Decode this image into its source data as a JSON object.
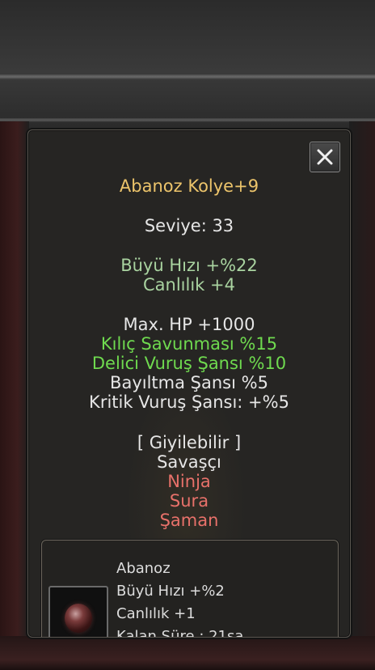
{
  "item": {
    "name": "Abanoz Kolye+9",
    "level": "Seviye: 33",
    "base_stats": [
      "Büyü Hızı +%22",
      "Canlılık +4"
    ],
    "bonuses": [
      {
        "text": "Max. HP +1000",
        "color": "#e6e6e6"
      },
      {
        "text": "Kılıç Savunması %15",
        "color": "#6fda4f"
      },
      {
        "text": "Delici Vuruş Şansı %10",
        "color": "#6fda4f"
      },
      {
        "text": "Bayıltma Şansı %5",
        "color": "#e6e6e6"
      },
      {
        "text": "Kritik Vuruş Şansı: +%5",
        "color": "#e6e6e6"
      }
    ],
    "wearable_label": "[ Giyilebilir ]",
    "classes": [
      {
        "text": "Savaşçı",
        "allowed": true
      },
      {
        "text": "Ninja",
        "allowed": false
      },
      {
        "text": "Sura",
        "allowed": false
      },
      {
        "text": "Şaman",
        "allowed": false
      }
    ]
  },
  "attached": {
    "name": "Abanoz",
    "stats": [
      "Büyü Hızı +%2",
      "Canlılık +1"
    ],
    "duration_partial": "Kalan Süre : 21sa"
  },
  "icons": {
    "close": "close-icon",
    "gem": "gem-icon"
  },
  "colors": {
    "name": "#ecc46b",
    "base_stat": "#a9d3a0",
    "bonus_highlight": "#6fda4f",
    "restricted_class": "#e8716a",
    "panel_bg": "#262523"
  }
}
